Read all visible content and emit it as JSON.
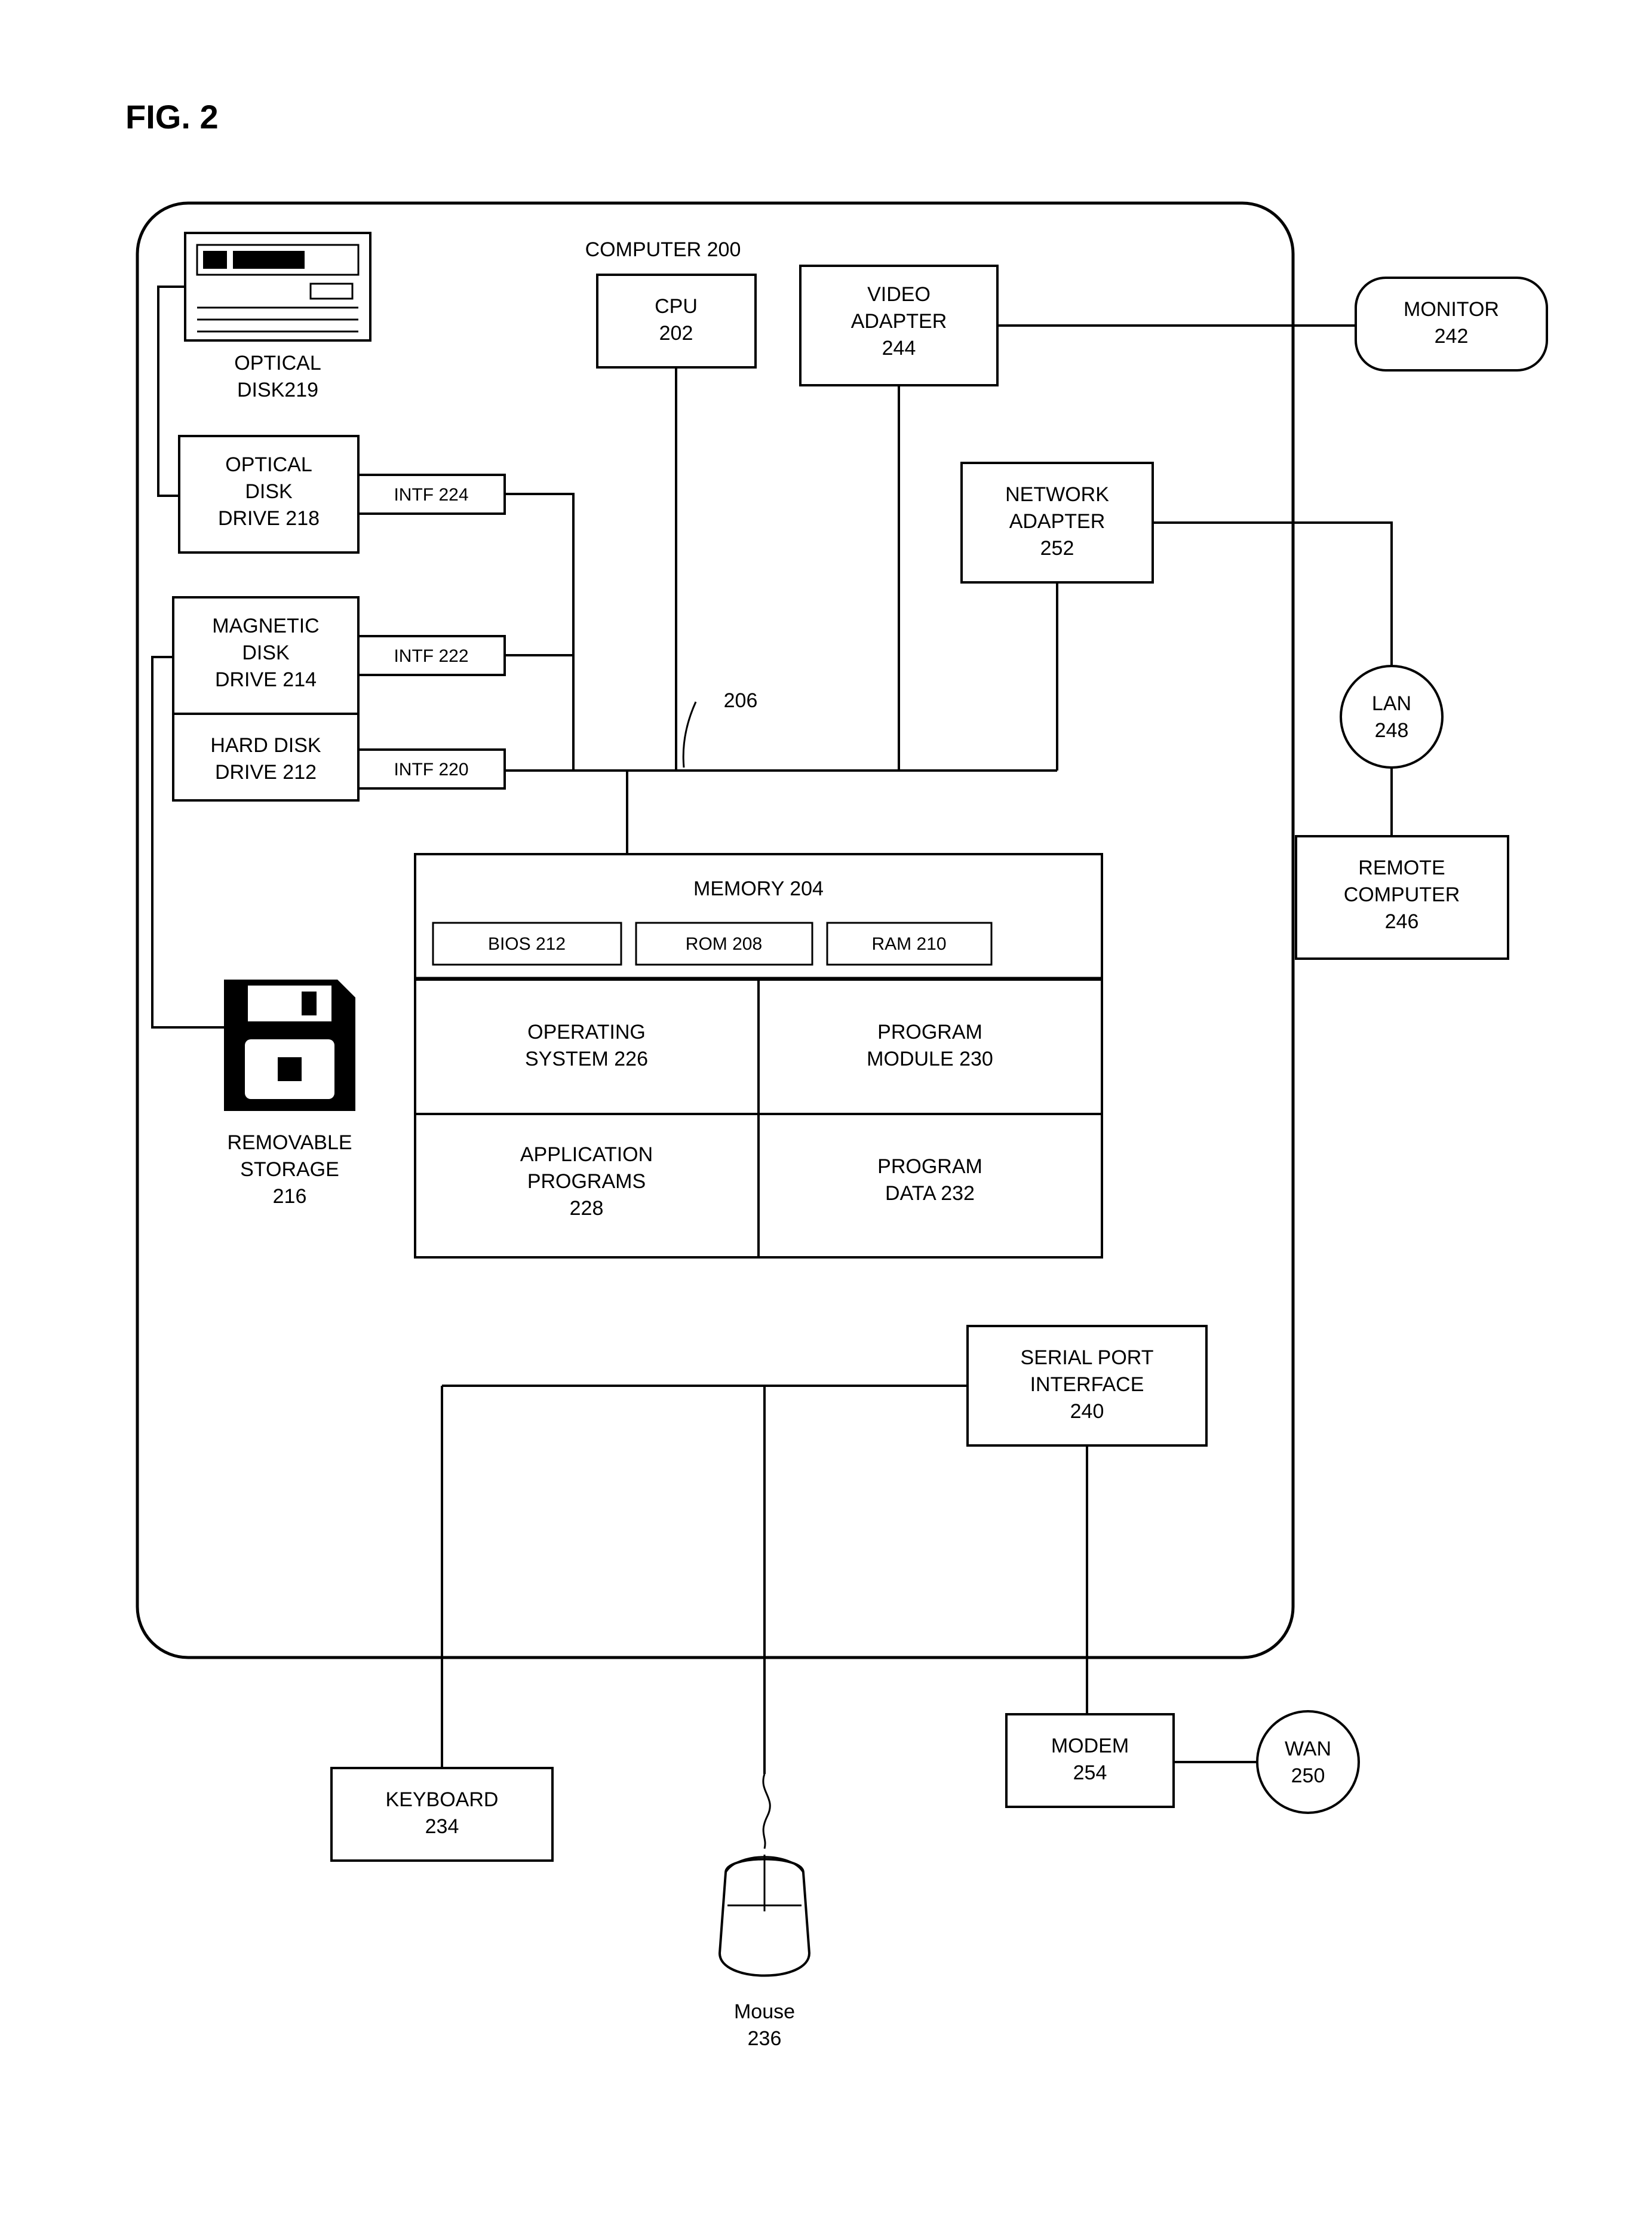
{
  "figure_label": "FIG. 2",
  "computer_title": "COMPUTER 200",
  "cpu": "CPU\n202",
  "video_adapter": "VIDEO\nADAPTER\n244",
  "monitor": "MONITOR\n242",
  "optical_disk_label": "OPTICAL\nDISK219",
  "optical_drive": "OPTICAL\nDISK\nDRIVE 218",
  "intf224": "INTF 224",
  "magnetic_drive": "MAGNETIC\nDISK\nDRIVE 214",
  "intf222": "INTF 222",
  "hard_drive": "HARD DISK\nDRIVE 212",
  "intf220": "INTF 220",
  "bus_ref": "206",
  "network_adapter": "NETWORK\nADAPTER\n252",
  "lan": "LAN\n248",
  "remote_computer": "REMOTE\nCOMPUTER\n246",
  "memory_title": "MEMORY 204",
  "bios": "BIOS 212",
  "rom": "ROM 208",
  "ram": "RAM 210",
  "os": "OPERATING\nSYSTEM 226",
  "prog_module": "PROGRAM\nMODULE 230",
  "app_prog": "APPLICATION\nPROGRAMS\n228",
  "prog_data": "PROGRAM\nDATA 232",
  "removable_storage": "REMOVABLE\nSTORAGE\n216",
  "serial_port": "SERIAL PORT\nINTERFACE\n240",
  "modem": "MODEM\n254",
  "wan": "WAN\n250",
  "keyboard": "KEYBOARD\n234",
  "mouse": "Mouse\n236"
}
